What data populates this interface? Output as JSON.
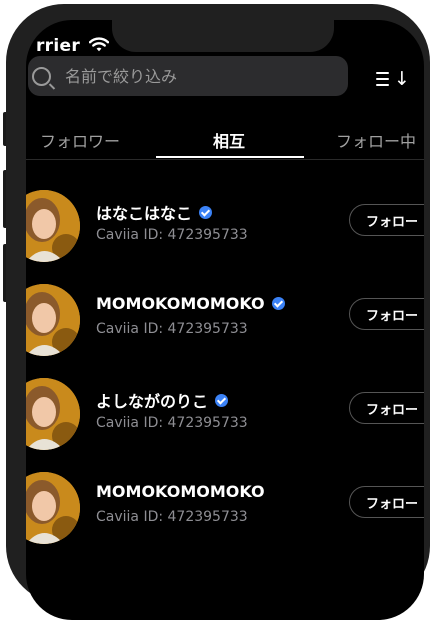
{
  "status": {
    "carrier": "rrier",
    "wifi_icon": "wifi-icon"
  },
  "search": {
    "placeholder": "名前で絞り込み",
    "value": ""
  },
  "tabs": [
    {
      "label": "フォロワー",
      "active": false
    },
    {
      "label": "相互",
      "active": true
    },
    {
      "label": "フォロー中",
      "active": false
    }
  ],
  "users": [
    {
      "name": "はなこはなこ",
      "verified": true,
      "id": "Caviia ID: 472395733",
      "button": "フォロー"
    },
    {
      "name": "MOMOKOMOMOKO",
      "verified": true,
      "id": "Caviia ID: 472395733",
      "button": "フォロー"
    },
    {
      "name": "よしながのりこ",
      "verified": true,
      "id": "Caviia ID: 472395733",
      "button": "フォロー"
    },
    {
      "name": "MOMOKOMOMOKO",
      "verified": false,
      "id": "Caviia ID: 472395733",
      "button": "フォロー"
    }
  ],
  "colors": {
    "background": "#000000",
    "verified": "#3b82f6",
    "search_bg": "#2c2c2e"
  }
}
